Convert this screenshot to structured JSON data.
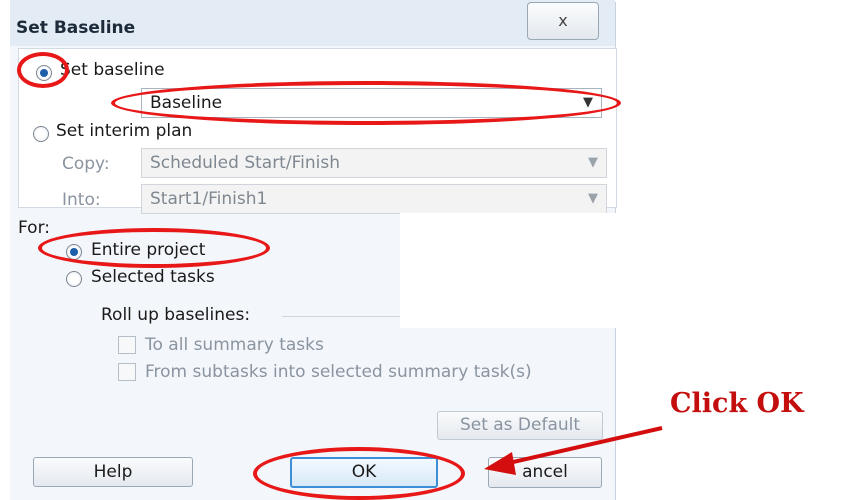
{
  "dialog": {
    "title": "Set Baseline",
    "close_glyph": "ⅹ"
  },
  "baseline_options": {
    "set_baseline_label": "Set baseline",
    "set_baseline_selected": true,
    "baseline_value": "Baseline",
    "set_interim_label": "Set interim plan",
    "set_interim_selected": false,
    "copy_label": "Copy:",
    "copy_value": "Scheduled Start/Finish",
    "into_label": "Into:",
    "into_value": "Start1/Finish1"
  },
  "scope": {
    "for_label": "For:",
    "entire_project_label": "Entire project",
    "entire_project_selected": true,
    "selected_tasks_label": "Selected tasks",
    "selected_tasks_selected": false,
    "roll_up_label": "Roll up baselines:",
    "to_all_summary_label": "To all summary tasks",
    "from_subtasks_label": "From subtasks into selected summary task(s)"
  },
  "buttons": {
    "set_default": "Set as Default",
    "help": "Help",
    "ok": "OK",
    "cancel": "ancel"
  },
  "annotation": {
    "callout_text": "Click OK",
    "highlight_color": "#e81818"
  }
}
